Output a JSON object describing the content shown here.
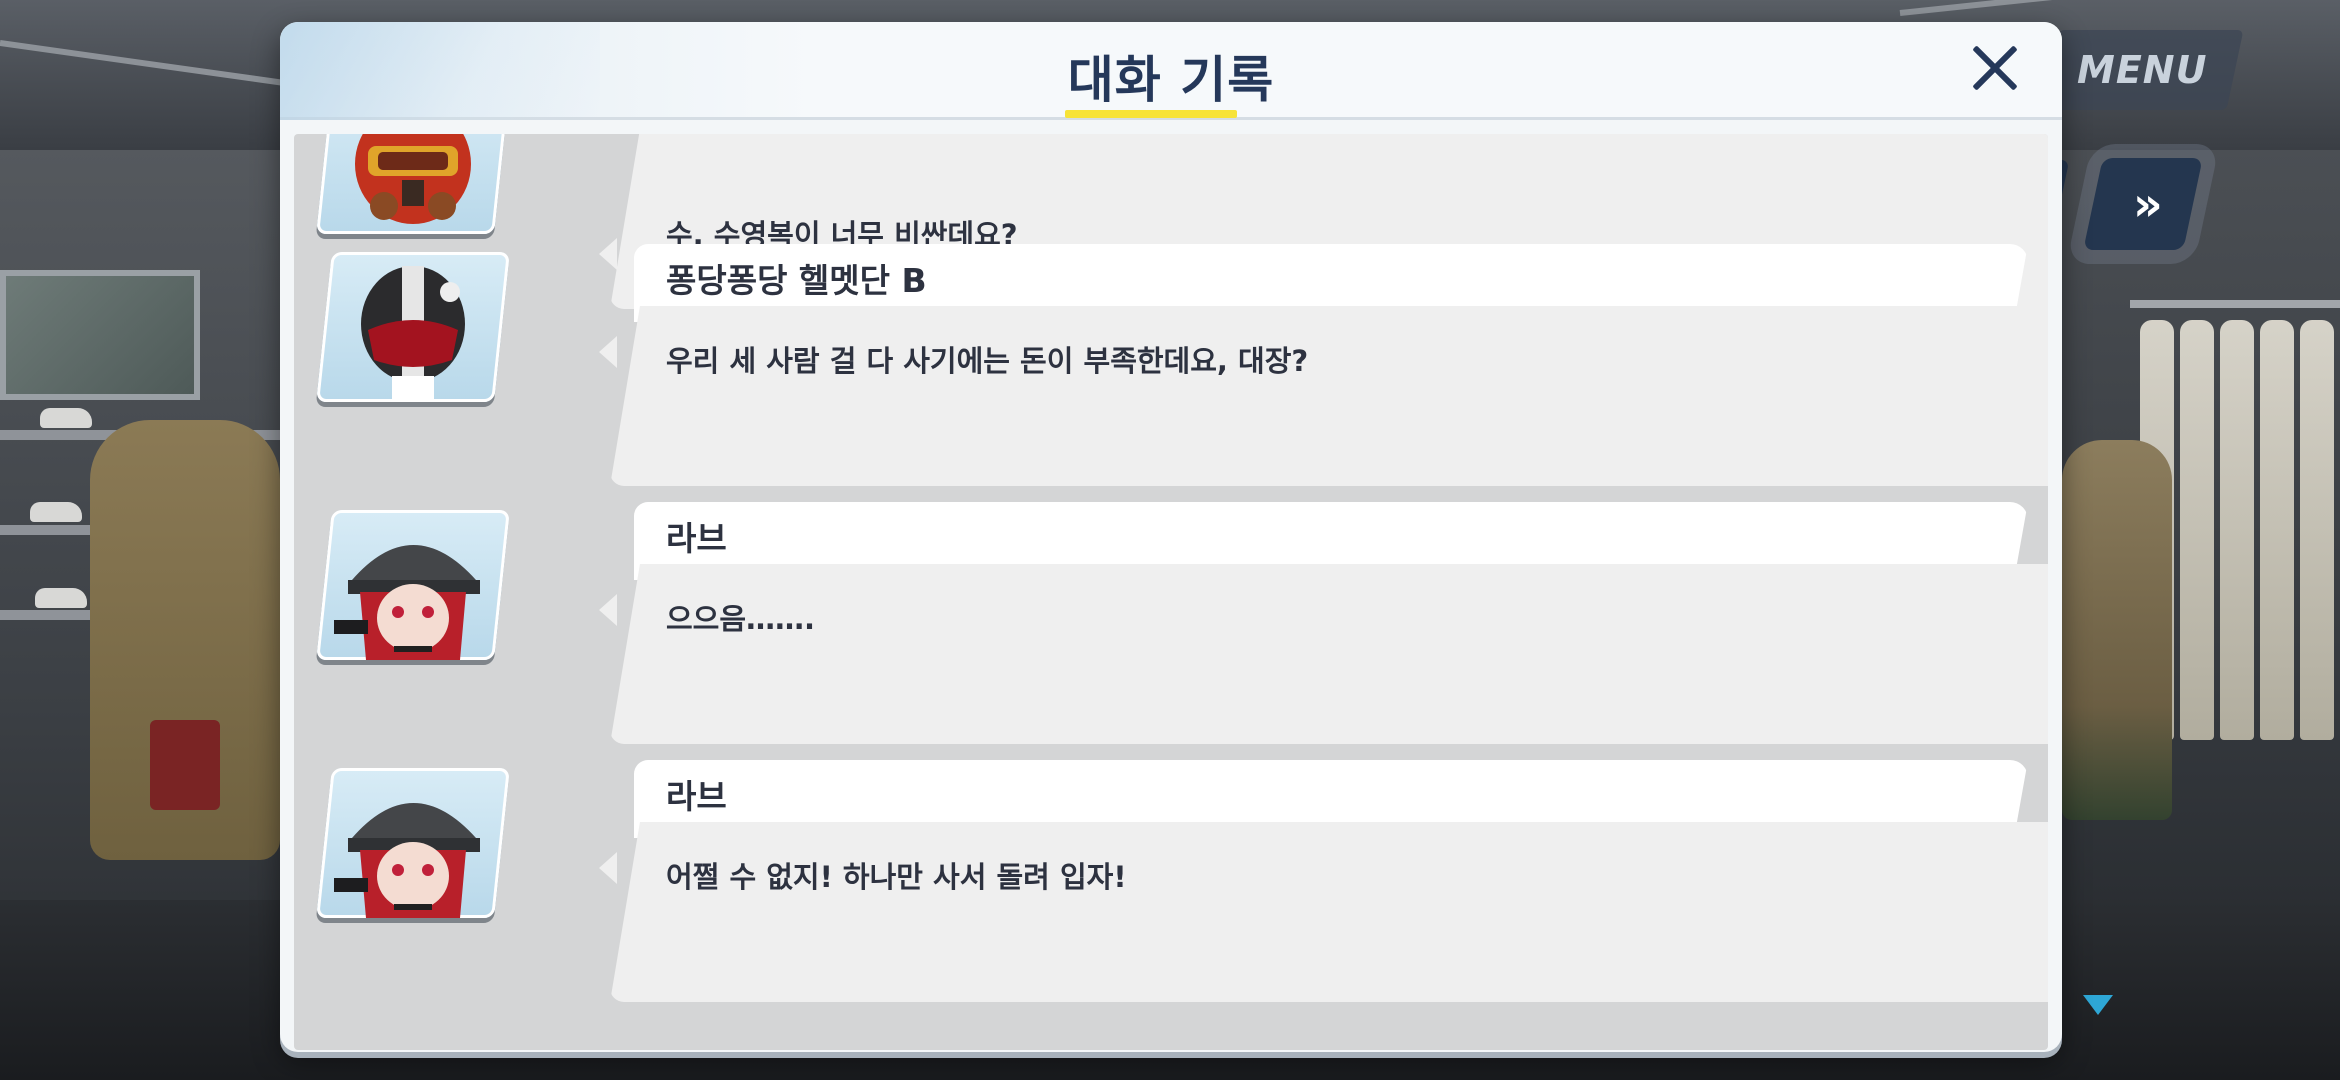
{
  "header": {
    "title": "대화 기록",
    "close_icon": "close-icon"
  },
  "controls": {
    "menu_label": "MENU",
    "auto_icon": "auto-icon",
    "skip_icon": "fast-forward-icon",
    "skip_glyph": "»"
  },
  "colors": {
    "title": "#25385a",
    "title_underline": "#f7e338",
    "control_bg": "#24364f",
    "scroll_arrow": "#2ea7d6"
  },
  "log": [
    {
      "speaker": "",
      "text": "수, 수영복이 너무 비싼데요?",
      "avatar": "red-helmet-portrait"
    },
    {
      "speaker": "퐁당퐁당 헬멧단 B",
      "text": "우리 세 사람 걸 다 사기에는 돈이 부족한데요, 대장?",
      "avatar": "black-helmet-portrait"
    },
    {
      "speaker": "라브",
      "text": "으으음…….",
      "avatar": "red-haired-girl-portrait"
    },
    {
      "speaker": "라브",
      "text": "어쩔 수 없지! 하나만 사서 돌려 입자!",
      "avatar": "red-haired-girl-portrait"
    }
  ]
}
